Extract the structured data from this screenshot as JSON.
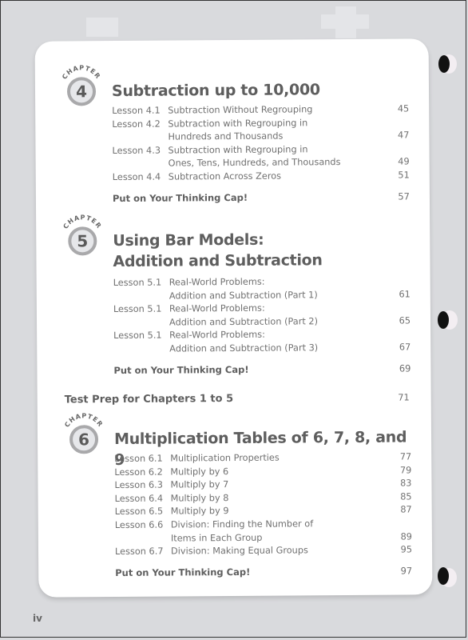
{
  "chapter_badge_label": "CHAPTER",
  "chapters": [
    {
      "number": "4",
      "title_lines": [
        "Subtraction up to 10,000"
      ],
      "lessons": [
        {
          "lesson": "Lesson 4.1",
          "lines": [
            "Subtraction Without Regrouping"
          ],
          "page": "45"
        },
        {
          "lesson": "Lesson 4.2",
          "lines": [
            "Subtraction with Regrouping in",
            "Hundreds and Thousands"
          ],
          "page": "47"
        },
        {
          "lesson": "Lesson 4.3",
          "lines": [
            "Subtraction with Regrouping in",
            "Ones, Tens, Hundreds, and Thousands"
          ],
          "page": "49"
        },
        {
          "lesson": "Lesson 4.4",
          "lines": [
            "Subtraction Across Zeros"
          ],
          "page": "51"
        }
      ],
      "thinking_cap": {
        "label": "Put on Your Thinking Cap!",
        "page": "57"
      }
    },
    {
      "number": "5",
      "title_lines": [
        "Using Bar Models:",
        "Addition and Subtraction"
      ],
      "lessons": [
        {
          "lesson": "Lesson 5.1",
          "lines": [
            "Real-World Problems:",
            "Addition and Subtraction (Part 1)"
          ],
          "page": "61"
        },
        {
          "lesson": "Lesson 5.1",
          "lines": [
            "Real-World Problems:",
            "Addition and Subtraction (Part 2)"
          ],
          "page": "65"
        },
        {
          "lesson": "Lesson 5.1",
          "lines": [
            "Real-World Problems:",
            "Addition and Subtraction (Part 3)"
          ],
          "page": "67"
        }
      ],
      "thinking_cap": {
        "label": "Put on Your Thinking Cap!",
        "page": "69"
      }
    },
    {
      "number": "6",
      "title_lines": [
        "Multiplication Tables of 6, 7, 8, and 9"
      ],
      "lessons": [
        {
          "lesson": "Lesson 6.1",
          "lines": [
            "Multiplication Properties"
          ],
          "page": "77"
        },
        {
          "lesson": "Lesson 6.2",
          "lines": [
            "Multiply by 6"
          ],
          "page": "79"
        },
        {
          "lesson": "Lesson 6.3",
          "lines": [
            "Multiply by 7"
          ],
          "page": "83"
        },
        {
          "lesson": "Lesson 6.4",
          "lines": [
            "Multiply by 8"
          ],
          "page": "85"
        },
        {
          "lesson": "Lesson 6.5",
          "lines": [
            "Multiply by 9"
          ],
          "page": "87"
        },
        {
          "lesson": "Lesson 6.6",
          "lines": [
            "Division: Finding the Number of",
            "Items in Each Group"
          ],
          "page": "89"
        },
        {
          "lesson": "Lesson 6.7",
          "lines": [
            "Division: Making Equal Groups"
          ],
          "page": "95"
        }
      ],
      "thinking_cap": {
        "label": "Put on Your Thinking Cap!",
        "page": "97"
      }
    }
  ],
  "test_prep": {
    "label": "Test Prep for Chapters 1 to 5",
    "page": "71"
  },
  "footer_page_number": "iv",
  "colors": {
    "background": "#d9dadd",
    "card": "#ffffff",
    "text": "#6b6b6b",
    "badge_ring": "#a9a9ab",
    "badge_fill": "#e6e7ea"
  }
}
